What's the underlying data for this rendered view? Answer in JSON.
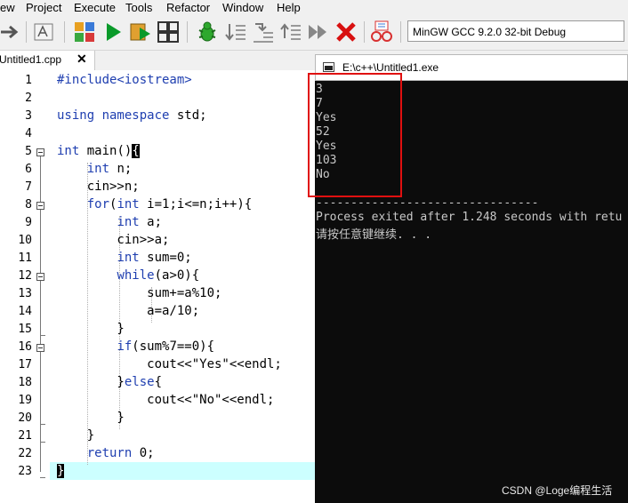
{
  "menu": {
    "items": [
      "ew",
      "Project",
      "Execute",
      "Tools",
      "Refactor",
      "Window",
      "Help"
    ]
  },
  "toolbar": {
    "compiler": "MinGW GCC 9.2.0 32-bit Debug"
  },
  "tab": {
    "filename": "Untitled1.cpp",
    "close": "✕"
  },
  "editor": {
    "line_numbers": [
      "1",
      "2",
      "3",
      "4",
      "5",
      "6",
      "7",
      "8",
      "9",
      "10",
      "11",
      "12",
      "13",
      "14",
      "15",
      "16",
      "17",
      "18",
      "19",
      "20",
      "21",
      "22",
      "23"
    ],
    "lines": [
      "#include<iostream>",
      "",
      "using namespace std;",
      "",
      "int main(){",
      "    int n;",
      "    cin>>n;",
      "    for(int i=1;i<=n;i++){",
      "        int a;",
      "        cin>>a;",
      "        int sum=0;",
      "        while(a>0){",
      "            sum+=a%10;",
      "            a=a/10;",
      "        }",
      "        if(sum%7==0){",
      "            cout<<\"Yes\"<<endl;",
      "        }else{",
      "            cout<<\"No\"<<endl;",
      "        }",
      "    }",
      "    return 0;",
      "}"
    ]
  },
  "console": {
    "title": "E:\\c++\\Untitled1.exe",
    "output": [
      "3",
      "7",
      "Yes",
      "52",
      "Yes",
      "103",
      "No"
    ],
    "separator": "--------------------------------",
    "process_line": "Process exited after 1.248 seconds with retu",
    "press_key": "请按任意键继续. . ."
  },
  "watermark": "CSDN @Loge编程生活",
  "colors": {
    "keyword": "#1f3fb0",
    "console_bg": "#0c0c0c",
    "console_text": "#c8c8c8",
    "current_line": "#ccffff",
    "highlight_box": "#e01010"
  }
}
